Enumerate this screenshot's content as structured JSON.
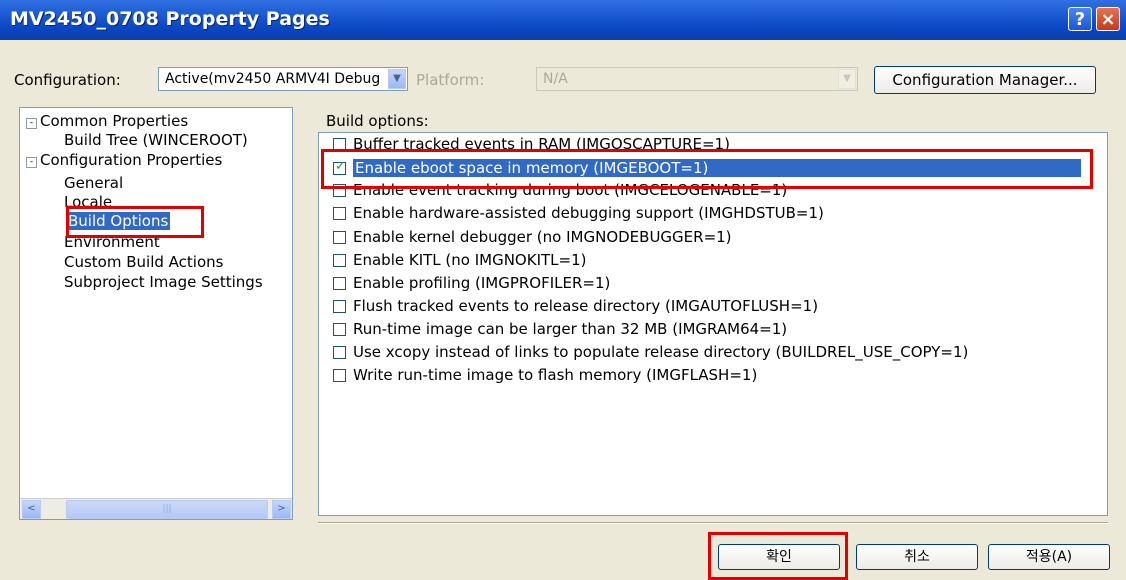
{
  "window": {
    "title": "MV2450_0708 Property Pages",
    "help_glyph": "?",
    "close_glyph": "×"
  },
  "config": {
    "configuration_label": "Configuration:",
    "configuration_value": "Active(mv2450 ARMV4I Debug",
    "platform_label": "Platform:",
    "platform_value": "N/A",
    "manager_button": "Configuration Manager..."
  },
  "tree": {
    "items": [
      {
        "label": "Common Properties",
        "expand": "-"
      },
      {
        "label": "Build Tree (WINCEROOT)"
      },
      {
        "label": "Configuration Properties",
        "expand": "-"
      },
      {
        "label": "General"
      },
      {
        "label": "Locale"
      },
      {
        "label": "Build Options"
      },
      {
        "label": "Environment"
      },
      {
        "label": "Custom Build Actions"
      },
      {
        "label": "Subproject Image Settings"
      }
    ]
  },
  "build_options": {
    "heading": "Build options:",
    "options": [
      {
        "label": "Buffer tracked events in RAM (IMGOSCAPTURE=1)",
        "checked": false
      },
      {
        "label": "Enable eboot space in memory (IMGEBOOT=1)",
        "checked": true,
        "selected": true
      },
      {
        "label": "Enable event tracking during boot (IMGCELOGENABLE=1)",
        "checked": false
      },
      {
        "label": "Enable hardware-assisted debugging support (IMGHDSTUB=1)",
        "checked": false
      },
      {
        "label": "Enable kernel debugger (no IMGNODEBUGGER=1)",
        "checked": false
      },
      {
        "label": "Enable KITL (no IMGNOKITL=1)",
        "checked": false
      },
      {
        "label": "Enable profiling (IMGPROFILER=1)",
        "checked": false
      },
      {
        "label": "Flush tracked events to release directory (IMGAUTOFLUSH=1)",
        "checked": false
      },
      {
        "label": "Run-time image can be larger than 32 MB (IMGRAM64=1)",
        "checked": false
      },
      {
        "label": "Use xcopy instead of links to populate release directory (BUILDREL_USE_COPY=1)",
        "checked": false
      },
      {
        "label": "Write run-time image to flash memory (IMGFLASH=1)",
        "checked": false
      }
    ]
  },
  "buttons": {
    "ok": "확인",
    "cancel": "취소",
    "apply": "적용(A)"
  },
  "scrollbar": {
    "left_arrow": "<",
    "right_arrow": ">",
    "grip": "|||"
  },
  "colors": {
    "highlight": "#e00000",
    "selection": "#316ac5",
    "title_bar": "#0a47c3"
  }
}
